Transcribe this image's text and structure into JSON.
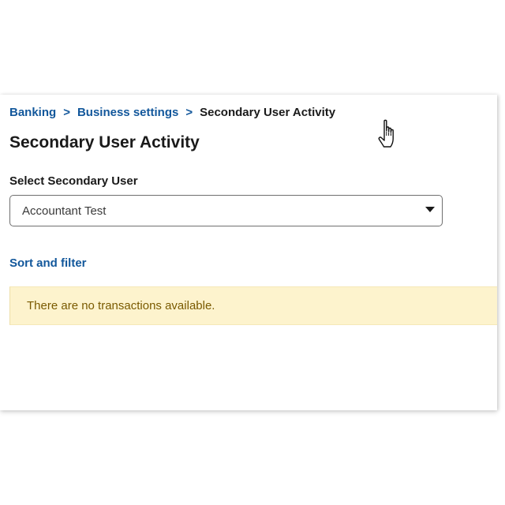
{
  "breadcrumb": {
    "items": [
      "Banking",
      "Business settings"
    ],
    "separator": ">",
    "current": "Secondary User Activity"
  },
  "page": {
    "title": "Secondary User Activity"
  },
  "user_select": {
    "label": "Select Secondary User",
    "value": "Accountant Test",
    "caret_icon": "caret-down-icon"
  },
  "sort_filter": {
    "label": "Sort and filter"
  },
  "notice": {
    "text": "There are no transactions available."
  },
  "cursor": {
    "icon": "hand-pointer-cursor-icon"
  },
  "colors": {
    "link": "#12579b",
    "text": "#1a1a1a",
    "notice_bg": "#fdf3cd",
    "notice_text": "#7a5a00"
  }
}
